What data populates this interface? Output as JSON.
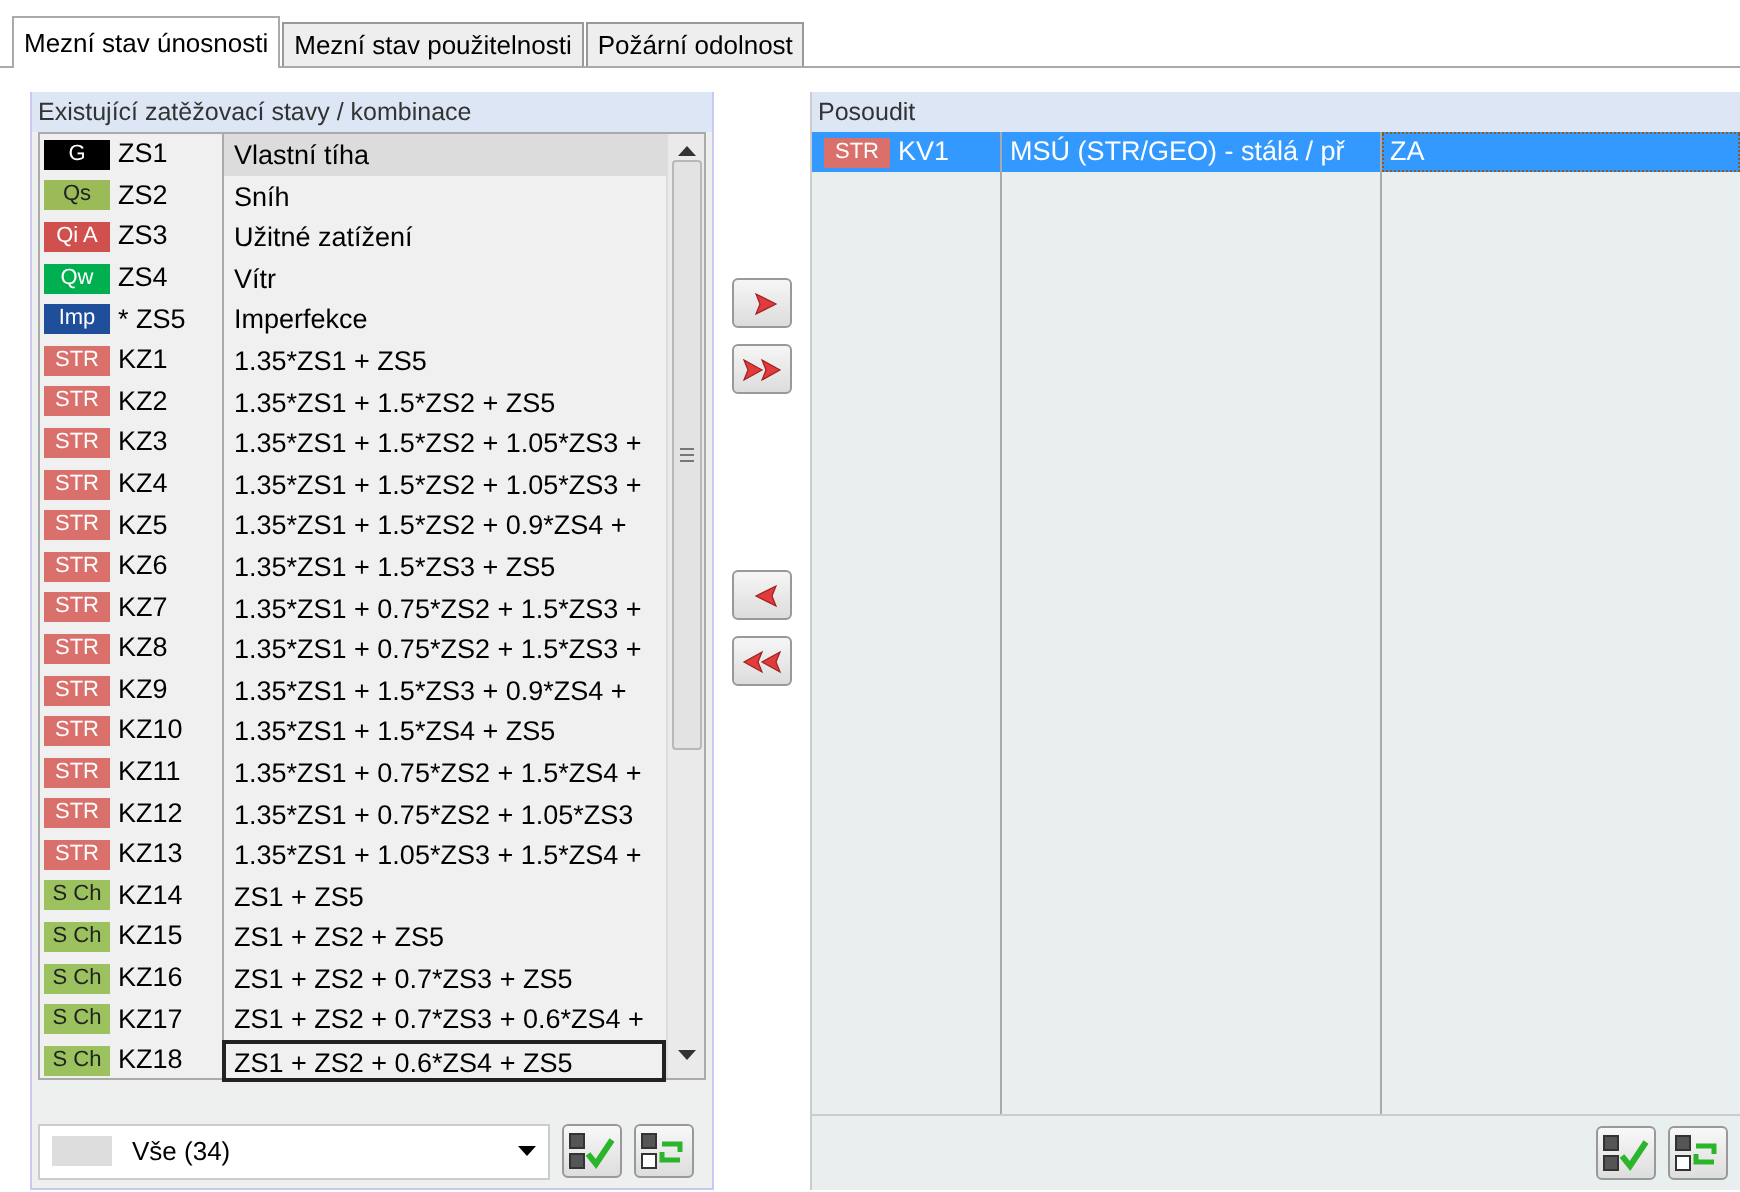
{
  "tabs": [
    {
      "label": "Mezní stav únosnosti",
      "selected": true
    },
    {
      "label": "Mezní stav použitelnosti",
      "selected": false
    },
    {
      "label": "Požární odolnost",
      "selected": false
    }
  ],
  "existing": {
    "title": "Existující zatěžovací stavy / kombinace",
    "rows": [
      {
        "tag": "G",
        "color": "#000000",
        "id": "ZS1",
        "description": "Vlastní tíha",
        "selected": true,
        "focused": false
      },
      {
        "tag": "Qs",
        "color": "#9bbb59",
        "id": "ZS2",
        "description": "Sníh",
        "selected": false,
        "focused": false
      },
      {
        "tag": "Qi A",
        "color": "#d0504d",
        "id": "ZS3",
        "description": "Užitné zatížení",
        "selected": false,
        "focused": false
      },
      {
        "tag": "Qw",
        "color": "#00b050",
        "id": "ZS4",
        "description": "Vítr",
        "selected": false,
        "focused": false
      },
      {
        "tag": "Imp",
        "color": "#1f4e9a",
        "id": "* ZS5",
        "description": "Imperfekce",
        "selected": false,
        "focused": false
      },
      {
        "tag": "STR",
        "color": "#d9706c",
        "id": "KZ1",
        "description": "1.35*ZS1 + ZS5",
        "selected": false,
        "focused": false
      },
      {
        "tag": "STR",
        "color": "#d9706c",
        "id": "KZ2",
        "description": "1.35*ZS1 + 1.5*ZS2 + ZS5",
        "selected": false,
        "focused": false
      },
      {
        "tag": "STR",
        "color": "#d9706c",
        "id": "KZ3",
        "description": "1.35*ZS1 + 1.5*ZS2 + 1.05*ZS3 +",
        "selected": false,
        "focused": false
      },
      {
        "tag": "STR",
        "color": "#d9706c",
        "id": "KZ4",
        "description": "1.35*ZS1 + 1.5*ZS2 + 1.05*ZS3 +",
        "selected": false,
        "focused": false
      },
      {
        "tag": "STR",
        "color": "#d9706c",
        "id": "KZ5",
        "description": "1.35*ZS1 + 1.5*ZS2 + 0.9*ZS4 +",
        "selected": false,
        "focused": false
      },
      {
        "tag": "STR",
        "color": "#d9706c",
        "id": "KZ6",
        "description": "1.35*ZS1 + 1.5*ZS3 + ZS5",
        "selected": false,
        "focused": false
      },
      {
        "tag": "STR",
        "color": "#d9706c",
        "id": "KZ7",
        "description": "1.35*ZS1 + 0.75*ZS2 + 1.5*ZS3 +",
        "selected": false,
        "focused": false
      },
      {
        "tag": "STR",
        "color": "#d9706c",
        "id": "KZ8",
        "description": "1.35*ZS1 + 0.75*ZS2 + 1.5*ZS3 +",
        "selected": false,
        "focused": false
      },
      {
        "tag": "STR",
        "color": "#d9706c",
        "id": "KZ9",
        "description": "1.35*ZS1 + 1.5*ZS3 + 0.9*ZS4 +",
        "selected": false,
        "focused": false
      },
      {
        "tag": "STR",
        "color": "#d9706c",
        "id": "KZ10",
        "description": "1.35*ZS1 + 1.5*ZS4 + ZS5",
        "selected": false,
        "focused": false
      },
      {
        "tag": "STR",
        "color": "#d9706c",
        "id": "KZ11",
        "description": "1.35*ZS1 + 0.75*ZS2 + 1.5*ZS4 +",
        "selected": false,
        "focused": false
      },
      {
        "tag": "STR",
        "color": "#d9706c",
        "id": "KZ12",
        "description": "1.35*ZS1 + 0.75*ZS2 + 1.05*ZS3",
        "selected": false,
        "focused": false
      },
      {
        "tag": "STR",
        "color": "#d9706c",
        "id": "KZ13",
        "description": "1.35*ZS1 + 1.05*ZS3 + 1.5*ZS4 +",
        "selected": false,
        "focused": false
      },
      {
        "tag": "S Ch",
        "color": "#9bc25f",
        "id": "KZ14",
        "description": "ZS1 + ZS5",
        "selected": false,
        "focused": false
      },
      {
        "tag": "S Ch",
        "color": "#9bc25f",
        "id": "KZ15",
        "description": "ZS1 + ZS2 + ZS5",
        "selected": false,
        "focused": false
      },
      {
        "tag": "S Ch",
        "color": "#9bc25f",
        "id": "KZ16",
        "description": "ZS1 + ZS2 + 0.7*ZS3 + ZS5",
        "selected": false,
        "focused": false
      },
      {
        "tag": "S Ch",
        "color": "#9bc25f",
        "id": "KZ17",
        "description": "ZS1 + ZS2 + 0.7*ZS3 + 0.6*ZS4 +",
        "selected": false,
        "focused": false
      },
      {
        "tag": "S Ch",
        "color": "#9bc25f",
        "id": "KZ18",
        "description": "ZS1 + ZS2 + 0.6*ZS4 + ZS5",
        "selected": false,
        "focused": true
      }
    ],
    "filter": {
      "value": "Vše (34)"
    }
  },
  "assess": {
    "title": "Posoudit",
    "rows": [
      {
        "tag": "STR",
        "color": "#d9706c",
        "id": "KV1",
        "description": "MSÚ (STR/GEO) - stálá / př",
        "column_3": "ZA",
        "selected": true
      }
    ]
  }
}
